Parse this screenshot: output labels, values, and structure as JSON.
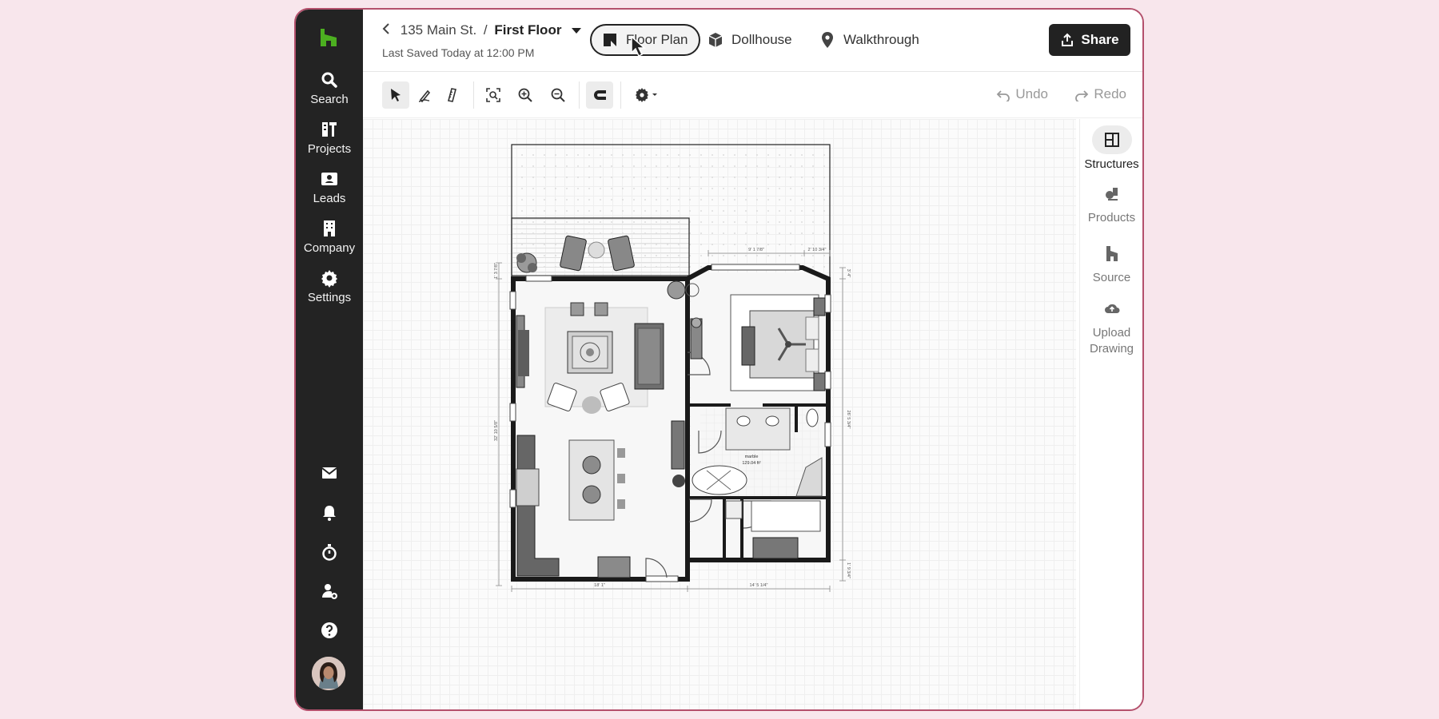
{
  "colors": {
    "accent": "#4caf20",
    "rail_bg": "#232323",
    "frame_border": "#b4506c",
    "page_bg": "#f8e6ec"
  },
  "rail": {
    "logo": "houzz-logo-icon",
    "items": [
      {
        "label": "Search",
        "icon": "search-icon"
      },
      {
        "label": "Projects",
        "icon": "projects-icon"
      },
      {
        "label": "Leads",
        "icon": "leads-icon"
      },
      {
        "label": "Company",
        "icon": "building-icon"
      },
      {
        "label": "Settings",
        "icon": "gear-icon"
      }
    ],
    "bottom_icons": [
      "mail-icon",
      "bell-icon",
      "timer-icon",
      "add-user-icon",
      "help-icon",
      "avatar"
    ]
  },
  "header": {
    "project": "135 Main St.",
    "separator": "/",
    "floor": "First Floor",
    "saved": "Last Saved Today at 12:00 PM",
    "views": [
      {
        "label": "Floor Plan",
        "icon": "floor-plan-icon",
        "active": true
      },
      {
        "label": "Dollhouse",
        "icon": "cube-icon",
        "active": false
      },
      {
        "label": "Walkthrough",
        "icon": "location-pin-icon",
        "active": false
      }
    ],
    "share_label": "Share"
  },
  "toolbar": {
    "tools": [
      "select-icon",
      "draw-wall-icon",
      "measure-icon",
      "zoom-fit-icon",
      "zoom-in-icon",
      "zoom-out-icon",
      "magnet-icon",
      "settings-dropdown-icon"
    ],
    "undo_label": "Undo",
    "redo_label": "Redo"
  },
  "right_panel": {
    "items": [
      {
        "label": "Structures",
        "icon": "structures-icon",
        "active": true
      },
      {
        "label": "Products",
        "icon": "products-icon",
        "active": false
      },
      {
        "label": "Source",
        "icon": "source-icon",
        "active": false
      },
      {
        "label": "Upload Drawing",
        "icon": "upload-cloud-icon",
        "active": false
      }
    ]
  },
  "floor_plan": {
    "room_label": "marble",
    "room_area": "129.04 ft²",
    "dimensions": {
      "bottom_left": "18' 1\"",
      "bottom_right": "14' 5 1/4\"",
      "top_right_a": "9' 1 7/8\"",
      "top_right_b": "2' 10 3/4\"",
      "left_top": "1' 3 7/8\"",
      "left_main": "32' 10 5/8\"",
      "right_main": "26' 5 3/4\"",
      "right_top": "3' 4\"",
      "right_bottom": "1' 9 3/4\""
    }
  }
}
